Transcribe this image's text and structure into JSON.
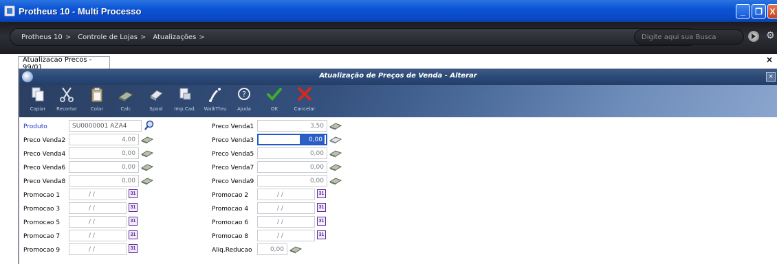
{
  "app": {
    "title": "Protheus 10 - Multi Processo"
  },
  "window_controls": {
    "minimize": "_",
    "restore": "❐",
    "close": "X"
  },
  "nav": {
    "breadcrumbs": [
      "Protheus 10",
      "Controle de Lojas",
      "Atualizações"
    ],
    "separator": ">",
    "search_placeholder": "Digite aqui sua Busca"
  },
  "tab": {
    "label": "Atualizacao Precos - 99/01",
    "close": "×"
  },
  "form_window": {
    "title": "Atualização de Preços de Venda - Alterar",
    "close": "×"
  },
  "toolbar": {
    "buttons": [
      {
        "label": "Copiar",
        "icon": "copy-icon"
      },
      {
        "label": "Recortar",
        "icon": "scissors-icon"
      },
      {
        "label": "Colar",
        "icon": "paste-icon"
      },
      {
        "label": "Calc",
        "icon": "calculator-icon"
      },
      {
        "label": "Spool",
        "icon": "spool-icon"
      },
      {
        "label": "Imp.Cad.",
        "icon": "print-icon"
      },
      {
        "label": "WalkThru",
        "icon": "walkthru-icon"
      },
      {
        "label": "Ajuda",
        "icon": "help-icon"
      },
      {
        "label": "OK",
        "icon": "check-icon"
      },
      {
        "label": "Cancelar",
        "icon": "cancel-icon"
      }
    ]
  },
  "fields": {
    "produto": {
      "label": "Produto",
      "value": "SU0000001 AZA4"
    },
    "preco_venda1": {
      "label": "Preco Venda1",
      "value": "3,50"
    },
    "preco_venda2": {
      "label": "Preco Venda2",
      "value": "4,00"
    },
    "preco_venda3": {
      "label": "Preco Venda3",
      "value": "0,00"
    },
    "preco_venda4": {
      "label": "Preco Venda4",
      "value": "0,00"
    },
    "preco_venda5": {
      "label": "Preco Venda5",
      "value": "0,00"
    },
    "preco_venda6": {
      "label": "Preco Venda6",
      "value": "0,00"
    },
    "preco_venda7": {
      "label": "Preco Venda7",
      "value": "0,00"
    },
    "preco_venda8": {
      "label": "Preco Venda8",
      "value": "0,00"
    },
    "preco_venda9": {
      "label": "Preco Venda9",
      "value": "0,00"
    },
    "promocao1": {
      "label": "Promocao 1",
      "value": "/ /"
    },
    "promocao2": {
      "label": "Promocao 2",
      "value": "/ /"
    },
    "promocao3": {
      "label": "Promocao 3",
      "value": "/ /"
    },
    "promocao4": {
      "label": "Promocao 4",
      "value": "/ /"
    },
    "promocao5": {
      "label": "Promocao 5",
      "value": "/ /"
    },
    "promocao6": {
      "label": "Promocao 6",
      "value": "/ /"
    },
    "promocao7": {
      "label": "Promocao 7",
      "value": "/ /"
    },
    "promocao8": {
      "label": "Promocao 8",
      "value": "/ /"
    },
    "promocao9": {
      "label": "Promocao 9",
      "value": "/ /"
    },
    "aliq_reducao": {
      "label": "Aliq.Reducao",
      "value": "0,00"
    }
  },
  "calendar_icon_text": "31",
  "colors": {
    "titlebar": "#0b54d6",
    "label_link": "#1b35c9",
    "active_field": "#2b5fc6",
    "ok": "#3cae2c",
    "cancel": "#d42a1c"
  }
}
